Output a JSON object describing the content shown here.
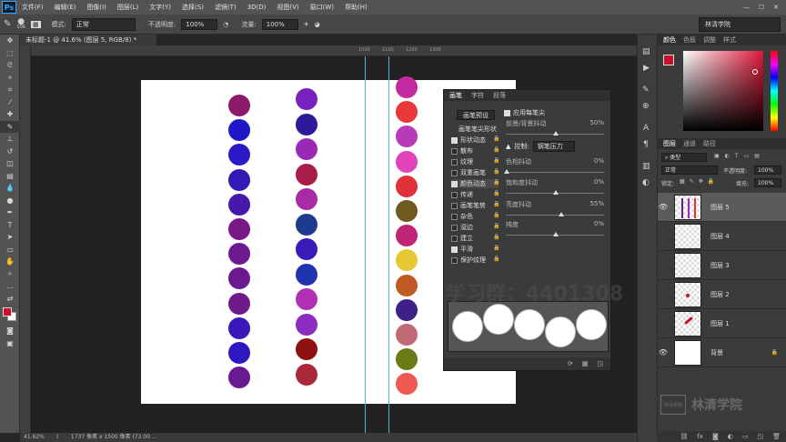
{
  "app": {
    "logo": "Ps"
  },
  "menu": [
    "文件(F)",
    "编辑(E)",
    "图像(I)",
    "图层(L)",
    "文字(Y)",
    "选择(S)",
    "滤镜(T)",
    "3D(D)",
    "视图(V)",
    "窗口(W)",
    "帮助(H)"
  ],
  "options": {
    "brush_size": "106",
    "mode_label": "模式:",
    "mode_value": "正常",
    "opacity_label": "不透明度:",
    "opacity_value": "100%",
    "flow_label": "流量:",
    "flow_value": "100%",
    "workspace": "林清学院"
  },
  "document": {
    "tab_title": "未标题-1 @ 41.6% (图层 5, RGB/8) *",
    "zoom": "41.62%",
    "doc_size": "1737 像素 x 1500 像素 (72.00 ...",
    "ruler_marks": [
      "1000",
      "1100",
      "1200",
      "1300"
    ]
  },
  "canvas_columns": {
    "col1": [
      "#8b1a6b",
      "#1f18c8",
      "#2a19c4",
      "#3419b6",
      "#4418a8",
      "#7a188a",
      "#6c1a90",
      "#6a1a8e",
      "#6e1a8a",
      "#3a18bc",
      "#2e18c0",
      "#6a1a90"
    ],
    "col2": [
      "#7a22c0",
      "#2c1a9a",
      "#9a2ab6",
      "#a81c48",
      "#a82aa6",
      "#1e3a8c",
      "#3a1ab8",
      "#2034b0",
      "#b030b4",
      "#8c2cc0",
      "#8e1212",
      "#a8283c"
    ],
    "col3": [
      "#c22a9e",
      "#e8383a",
      "#b83ab8",
      "#e044b8",
      "#e0303a",
      "#6e5a20",
      "#c02474",
      "#e6c832",
      "#c05a24",
      "#3e2088",
      "#c06a76",
      "#6a7a16",
      "#ee5a52"
    ]
  },
  "brush_panel": {
    "tabs": [
      "画笔",
      "字符",
      "段落"
    ],
    "preset_button": "画笔预设",
    "tip_shape": "画笔笔尖形状",
    "items": [
      {
        "label": "形状动态",
        "checked": true
      },
      {
        "label": "散布",
        "checked": false
      },
      {
        "label": "纹理",
        "checked": false
      },
      {
        "label": "双重画笔",
        "checked": false
      },
      {
        "label": "颜色动态",
        "checked": true
      },
      {
        "label": "传递",
        "checked": false
      },
      {
        "label": "画笔笔势",
        "checked": false
      },
      {
        "label": "杂色",
        "checked": false
      },
      {
        "label": "湿边",
        "checked": false
      },
      {
        "label": "建立",
        "checked": false
      },
      {
        "label": "平滑",
        "checked": true
      },
      {
        "label": "保护纹理",
        "checked": false
      }
    ],
    "apply_per_tip": "应用每笔尖",
    "fg_bg_jitter": {
      "label": "前景/背景抖动",
      "value": "50%"
    },
    "control_label": "控制:",
    "control_value": "钢笔压力",
    "hue_jitter": {
      "label": "色相抖动",
      "value": "0%"
    },
    "sat_jitter": {
      "label": "饱和度抖动",
      "value": "0%"
    },
    "bright_jitter": {
      "label": "亮度抖动",
      "value": "55%"
    },
    "purity": {
      "label": "纯度",
      "value": "0%"
    }
  },
  "watermark_group": "学习群：4401308",
  "color_panel": {
    "tabs": [
      "颜色",
      "色板",
      "调整",
      "样式"
    ],
    "foreground": "#c8102e"
  },
  "layers_panel": {
    "tabs": [
      "图层",
      "通道",
      "路径"
    ],
    "kind": "类型",
    "blend": "正常",
    "opacity_label": "不透明度:",
    "opacity": "100%",
    "lock_label": "锁定:",
    "fill_label": "填充:",
    "fill": "100%",
    "layers": [
      {
        "name": "图层 5",
        "visible": true,
        "selected": true
      },
      {
        "name": "图层 4",
        "visible": false,
        "selected": false
      },
      {
        "name": "图层 3",
        "visible": false,
        "selected": false
      },
      {
        "name": "图层 2",
        "visible": false,
        "selected": false
      },
      {
        "name": "图层 1",
        "visible": false,
        "selected": false
      },
      {
        "name": "背景",
        "visible": true,
        "selected": false
      }
    ]
  },
  "brand_watermark": {
    "box": "林清学院",
    "text": "林清学院"
  }
}
